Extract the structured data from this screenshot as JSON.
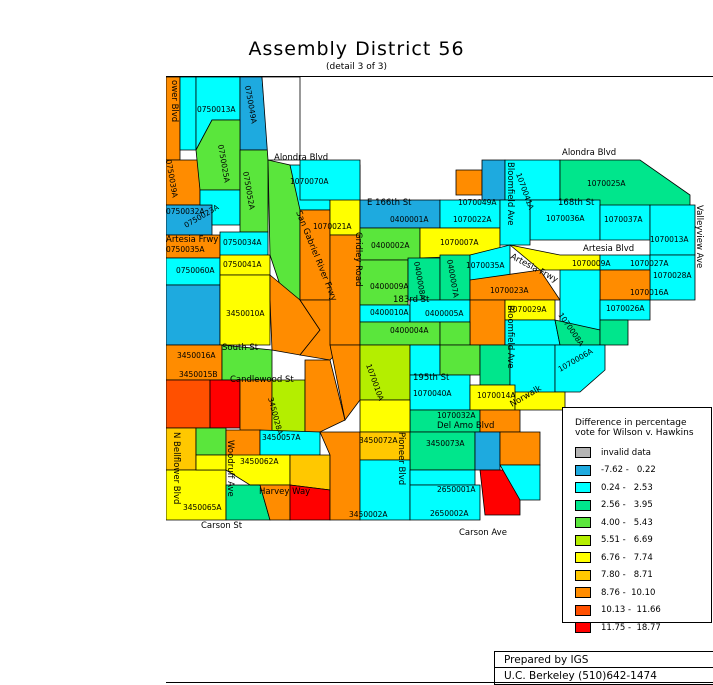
{
  "title": "Assembly District 56",
  "subtitle": "(detail 3 of 3)",
  "legend": {
    "title_line1": "Difference in percentage",
    "title_line2": "vote for Wilson v. Hawkins",
    "items": [
      {
        "label": "invalid data",
        "color": "#b4b4b4"
      },
      {
        "label": "-7.62 -   0.22",
        "color": "#1eaadf"
      },
      {
        "label": "0.24 -   2.53",
        "color": "#00ffff"
      },
      {
        "label": "2.56 -   3.95",
        "color": "#00e68c"
      },
      {
        "label": "4.00 -   5.43",
        "color": "#5ae63c"
      },
      {
        "label": "5.51 -   6.69",
        "color": "#b4ee00"
      },
      {
        "label": "6.76 -   7.74",
        "color": "#ffff00"
      },
      {
        "label": "7.80 -   8.71",
        "color": "#ffc800"
      },
      {
        "label": "8.76 -  10.10",
        "color": "#ff8c00"
      },
      {
        "label": "10.13 -  11.66",
        "color": "#ff5000"
      },
      {
        "label": "11.75 -  18.77",
        "color": "#ff0000"
      }
    ]
  },
  "credit": {
    "line1": "Prepared by IGS",
    "line2": "U.C. Berkeley (510)642-1474"
  },
  "streets": {
    "alondra_w": "Alondra Blvd",
    "alondra_e": "Alondra Blvd",
    "e166th": "E 166th St",
    "st168": "168th St",
    "artesia_e": "Artesia Blvd",
    "artesia_fwy_c": "Artesia Frwy",
    "artesia_fwy_w": "Artesia Frwy",
    "st183": "183rd St",
    "south": "South St",
    "candlewood": "Candlewood St",
    "st195": "195th St",
    "del_amo": "Del Amo Blvd",
    "harvey": "Harvey Way",
    "carson_w": "Carson St",
    "carson_e": "Carson Ave",
    "bloomfield_n": "Bloomfield Ave",
    "bloomfield_s": "Bloomfield Ave",
    "valleyview": "Valleyview Ave",
    "san_gabriel": "San Gabriel River Frwy",
    "gridley": "Gridley Road",
    "pioneer": "Pioneer Blvd",
    "woodruff": "Woodruff Ave",
    "bellflower": "N Bellflower Blvd",
    "lower_blvd": "ower Blvd",
    "norwalk": "Norwalk"
  },
  "precincts": {
    "p0750013A": "0750013A",
    "p0750049A": "0750049A",
    "p0750025A": "0750025A",
    "p0750034A": "0750034A",
    "p0750041A": "0750041A",
    "p0750060A": "0750060A",
    "p0750035A": "0750035A",
    "p0750032A": "0750032A",
    "p0750023A": "0750023A",
    "p0750039A": "0750039A",
    "p0750052A": "0750052A",
    "p1070070A": "1070070A",
    "p1070021A": "1070021A",
    "p0400001A": "0400001A",
    "p1070022A": "1070022A",
    "p1070049A": "1070049A",
    "p1070041A": "1070041A",
    "p1070025A": "1070025A",
    "p1070036A": "1070036A",
    "p1070037A": "1070037A",
    "p1070013A": "1070013A",
    "p0400002A": "0400002A",
    "p1070007A": "1070007A",
    "p1070035A": "1070035A",
    "p1070009A": "1070009A",
    "p1070027A": "1070027A",
    "p1070028A": "1070028A",
    "p1070016A": "1070016A",
    "p1070023A": "1070023A",
    "p1070026A": "1070026A",
    "p1070029A": "1070029A",
    "p0400009A": "0400009A",
    "p0400008A": "0400008A",
    "p0400007A": "0400007A",
    "p0400010A": "0400010A",
    "p0400005A": "0400005A",
    "p0400004A": "0400004A",
    "p3450010A": "3450010A",
    "p3450016A": "3450016A",
    "p3450015B": "3450015B",
    "p3450028A": "3450028A",
    "p3450057A": "3450057A",
    "p3450062A": "3450062A",
    "p3450065A": "3450065A",
    "p3450002A": "3450002A",
    "p3450072A": "3450072A",
    "p3450073A": "3450073A",
    "p2650001A": "2650001A",
    "p2650002A": "2650002A",
    "p1070040A": "1070040A",
    "p1070014A": "1070014A",
    "p1070032A": "1070032A",
    "p1070010A": "1070010A",
    "p1070008A": "1070008A",
    "p1070006A": "1070006A"
  }
}
